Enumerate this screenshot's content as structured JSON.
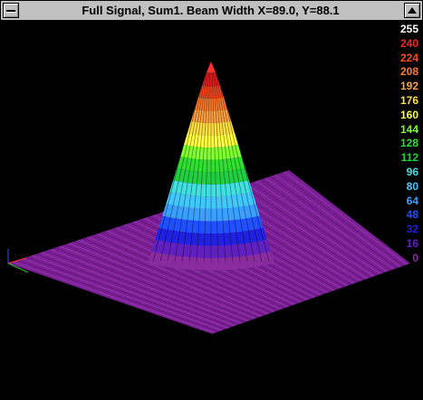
{
  "window": {
    "title": "Full Signal, Sum1. Beam Width X=89.0, Y=88.1"
  },
  "icons": {
    "system_menu": "system-menu-icon",
    "maximize": "maximize-arrow-icon"
  },
  "legend": {
    "levels": [
      {
        "label": "255",
        "color": "#ffffff"
      },
      {
        "label": "240",
        "color": "#ff2020"
      },
      {
        "label": "224",
        "color": "#ff4a1e"
      },
      {
        "label": "208",
        "color": "#ff7a2a"
      },
      {
        "label": "192",
        "color": "#ffa040"
      },
      {
        "label": "176",
        "color": "#ffe040"
      },
      {
        "label": "160",
        "color": "#ffff40"
      },
      {
        "label": "144",
        "color": "#80ff30"
      },
      {
        "label": "128",
        "color": "#30e030"
      },
      {
        "label": "112",
        "color": "#20d040"
      },
      {
        "label": "96",
        "color": "#40e0e0"
      },
      {
        "label": "80",
        "color": "#40c8ff"
      },
      {
        "label": "64",
        "color": "#3aa0ff"
      },
      {
        "label": "48",
        "color": "#2050ff"
      },
      {
        "label": "32",
        "color": "#2020e0"
      },
      {
        "label": "16",
        "color": "#6020c0"
      },
      {
        "label": "0",
        "color": "#8a2ca0"
      }
    ]
  },
  "beam_profile": {
    "peak_level": 255,
    "base_level": 0,
    "beam_width_x": 89.0,
    "beam_width_y": 88.1
  }
}
